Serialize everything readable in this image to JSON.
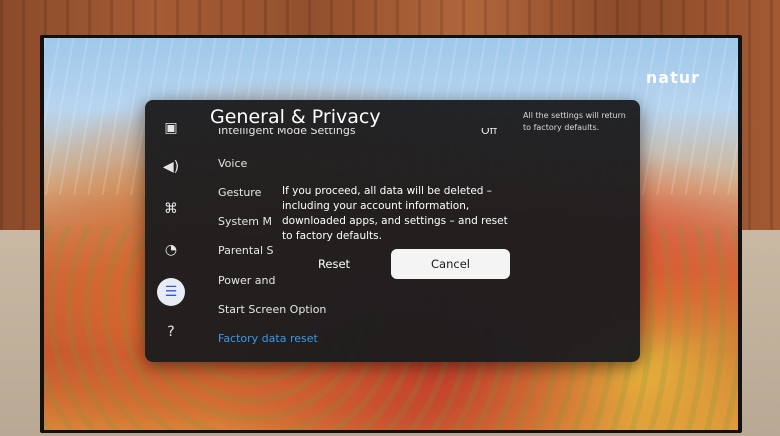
{
  "tv": {
    "brand_text": "natur",
    "accent_color": "#3a9ae8"
  },
  "menu": {
    "title": "General & Privacy",
    "icons": [
      {
        "name": "picture-icon",
        "glyph": "▣"
      },
      {
        "name": "sound-icon",
        "glyph": "◀)"
      },
      {
        "name": "connection-icon",
        "glyph": "⌘"
      },
      {
        "name": "support-icon",
        "glyph": "◔"
      },
      {
        "name": "general-privacy-icon",
        "glyph": "☰"
      },
      {
        "name": "help-icon",
        "glyph": "?"
      }
    ],
    "items": [
      {
        "label": "Intelligent Mode Settings",
        "value": "Off"
      },
      {
        "label": "Voice"
      },
      {
        "label": "Gesture"
      },
      {
        "label": "System M"
      },
      {
        "label": "Parental S"
      },
      {
        "label": "Power and"
      },
      {
        "label": "Start Screen Option"
      },
      {
        "label": "Factory data reset"
      }
    ],
    "side_description": "All the settings will return to factory defaults."
  },
  "dialog": {
    "message": "If you proceed, all data will be deleted – including your account information, downloaded apps, and settings – and reset to factory defaults.",
    "reset_label": "Reset",
    "cancel_label": "Cancel"
  }
}
